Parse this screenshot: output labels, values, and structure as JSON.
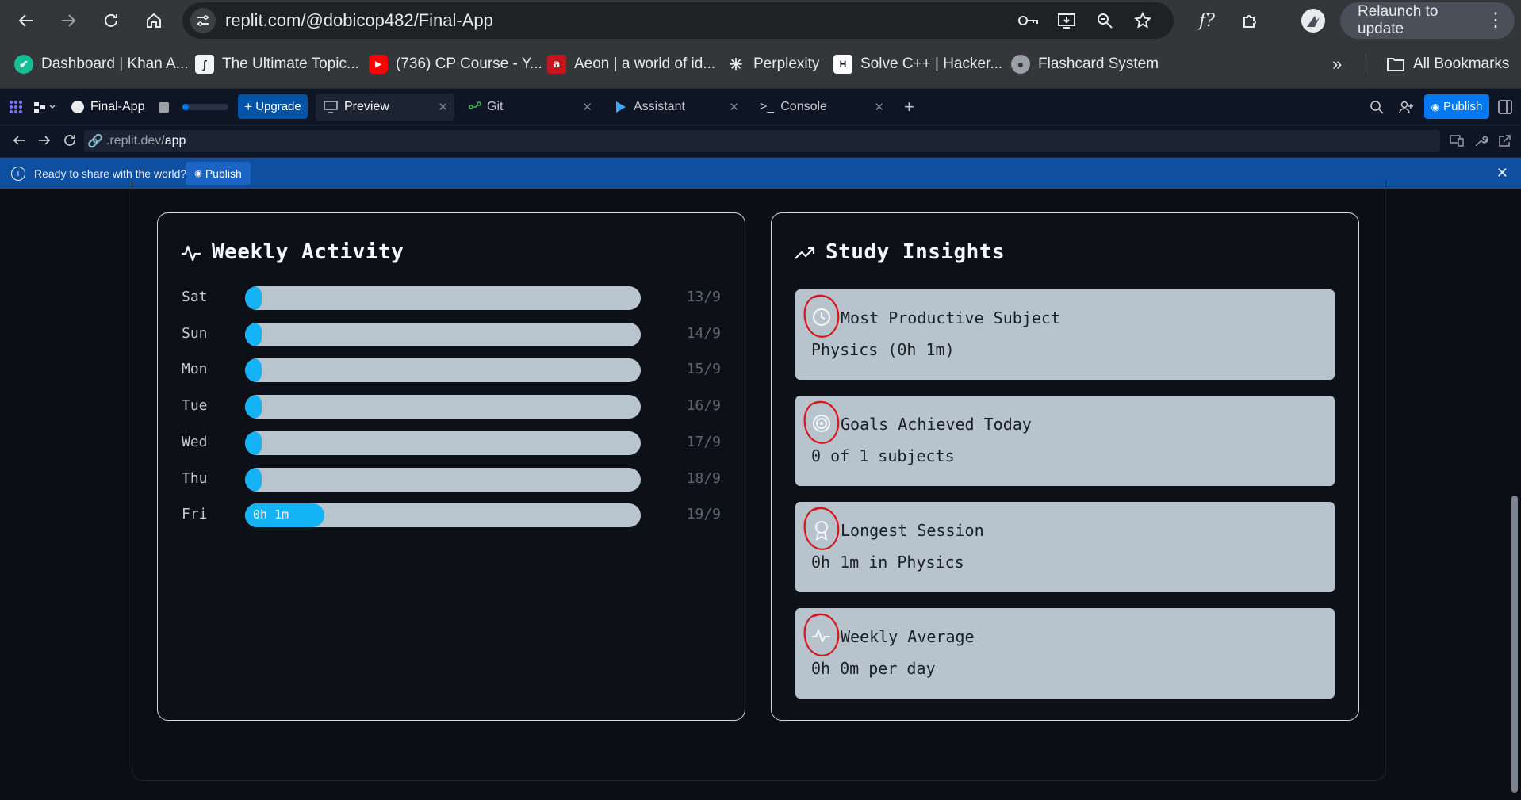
{
  "browser": {
    "url": "replit.com/@dobicop482/Final-App",
    "relaunch_label": "Relaunch to update",
    "bookmarks": [
      {
        "label": "Dashboard | Khan A...",
        "icon": "khan-academy-icon"
      },
      {
        "label": "The Ultimate Topic...",
        "icon": "topic-list-icon"
      },
      {
        "label": "(736) CP Course - Y...",
        "icon": "youtube-icon"
      },
      {
        "label": "Aeon | a world of id...",
        "icon": "aeon-icon"
      },
      {
        "label": "Perplexity",
        "icon": "perplexity-icon"
      },
      {
        "label": "Solve C++ | Hacker...",
        "icon": "hackerrank-icon"
      },
      {
        "label": "Flashcard System",
        "icon": "globe-icon"
      }
    ],
    "all_bookmarks_label": "All Bookmarks"
  },
  "workspace": {
    "project_name": "Final-App",
    "upgrade_label": "Upgrade",
    "tabs": [
      {
        "label": "Preview",
        "active": true
      },
      {
        "label": "Git",
        "active": false
      },
      {
        "label": "Assistant",
        "active": false
      },
      {
        "label": "Console",
        "active": false
      }
    ],
    "publish_label": "Publish"
  },
  "preview": {
    "url_prefix": ".replit.dev/",
    "url_path": "app"
  },
  "banner": {
    "message": "Ready to share with the world?",
    "publish_label": "Publish"
  },
  "weekly_activity": {
    "title": "Weekly Activity",
    "days": [
      {
        "day": "Sat",
        "date": "13/9",
        "fill_fraction": 0.0,
        "label": ""
      },
      {
        "day": "Sun",
        "date": "14/9",
        "fill_fraction": 0.0,
        "label": ""
      },
      {
        "day": "Mon",
        "date": "15/9",
        "fill_fraction": 0.0,
        "label": ""
      },
      {
        "day": "Tue",
        "date": "16/9",
        "fill_fraction": 0.0,
        "label": ""
      },
      {
        "day": "Wed",
        "date": "17/9",
        "fill_fraction": 0.0,
        "label": ""
      },
      {
        "day": "Thu",
        "date": "18/9",
        "fill_fraction": 0.0,
        "label": ""
      },
      {
        "day": "Fri",
        "date": "19/9",
        "fill_fraction": 0.2,
        "label": "0h 1m"
      }
    ]
  },
  "study_insights": {
    "title": "Study Insights",
    "items": [
      {
        "icon": "clock-icon",
        "title": "Most Productive Subject",
        "value": "Physics (0h 1m)"
      },
      {
        "icon": "target-icon",
        "title": "Goals Achieved Today",
        "value": "0 of 1 subjects"
      },
      {
        "icon": "award-icon",
        "title": "Longest Session",
        "value": "0h 1m in Physics"
      },
      {
        "icon": "activity-icon",
        "title": "Weekly Average",
        "value": "0h 0m per day"
      }
    ]
  },
  "colors": {
    "bar_fill": "#14b3f5",
    "bar_track": "#b8c4ce",
    "insight_bg": "#b7c4ce",
    "annotation_red": "#d8161b",
    "banner_blue": "#0f4fa0"
  }
}
